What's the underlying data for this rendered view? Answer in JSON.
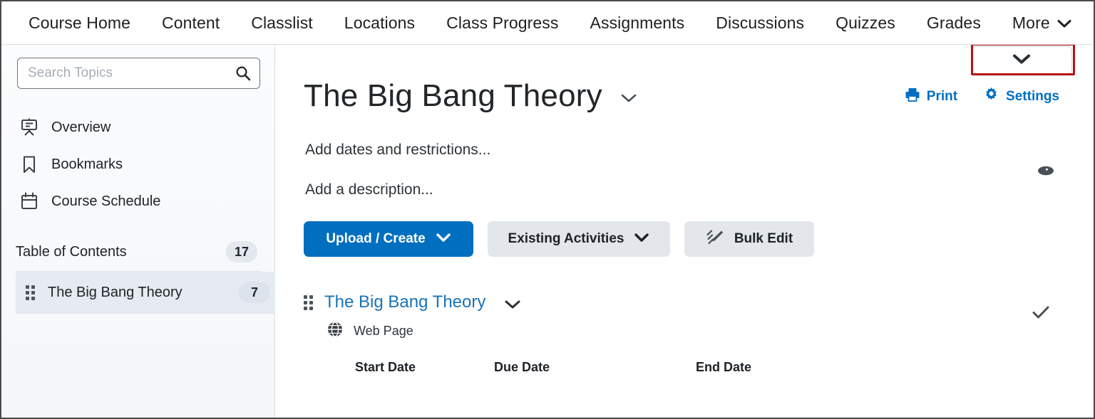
{
  "navbar": {
    "items": [
      {
        "label": "Course Home"
      },
      {
        "label": "Content"
      },
      {
        "label": "Classlist"
      },
      {
        "label": "Locations"
      },
      {
        "label": "Class Progress"
      },
      {
        "label": "Assignments"
      },
      {
        "label": "Discussions"
      },
      {
        "label": "Quizzes"
      },
      {
        "label": "Grades"
      },
      {
        "label": "More"
      }
    ]
  },
  "sidebar": {
    "search": {
      "value": "",
      "placeholder": "Search Topics"
    },
    "items": [
      {
        "label": "Overview",
        "icon": "projector-screen-icon"
      },
      {
        "label": "Bookmarks",
        "icon": "bookmark-icon"
      },
      {
        "label": "Course Schedule",
        "icon": "calendar-icon"
      }
    ],
    "toc": {
      "label": "Table of Contents",
      "count": "17"
    },
    "modules": [
      {
        "label": "The Big Bang Theory",
        "count": "7",
        "selected": true
      }
    ]
  },
  "main": {
    "title": "The Big Bang Theory",
    "print_label": "Print",
    "settings_label": "Settings",
    "dates_placeholder": "Add dates and restrictions...",
    "description_placeholder": "Add a description...",
    "buttons": {
      "upload_create": "Upload / Create",
      "existing_activities": "Existing Activities",
      "bulk_edit": "Bulk Edit"
    },
    "content_item": {
      "title": "The Big Bang Theory",
      "type": "Web Page"
    },
    "date_columns": [
      "Start Date",
      "Due Date",
      "End Date"
    ]
  },
  "colors": {
    "accent_blue": "#006fbf",
    "link_blue": "#1a73b8",
    "annotation_red": "#b31414",
    "sidebar_bg": "#f4f6f9",
    "selected_row": "#e6eaf1",
    "badge_bg": "#e3e8ee"
  }
}
